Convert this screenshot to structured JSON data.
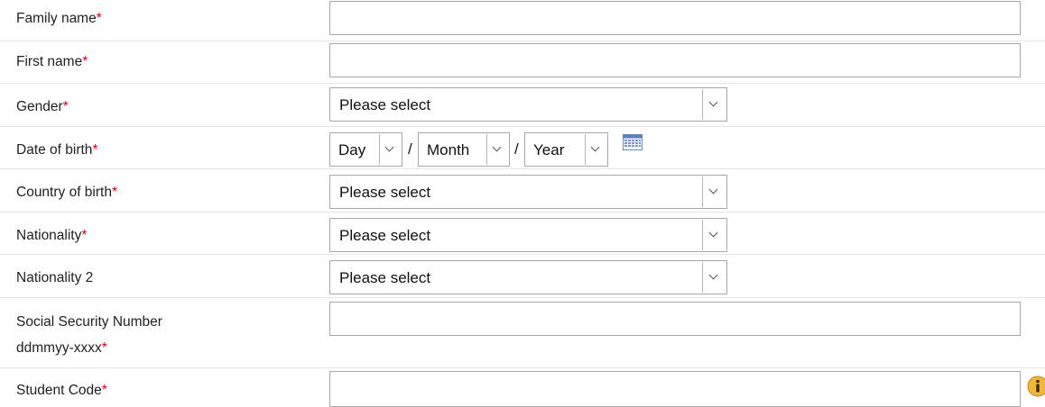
{
  "form": {
    "family_name": {
      "label": "Family name",
      "required": "*",
      "value": ""
    },
    "first_name": {
      "label": "First name",
      "required": "*",
      "value": ""
    },
    "gender": {
      "label": "Gender",
      "required": "*",
      "selected": "Please select"
    },
    "date_of_birth": {
      "label": "Date of birth",
      "required": "*",
      "day": "Day",
      "month": "Month",
      "year": "Year",
      "separator": "/",
      "calendar_icon": "calendar-icon"
    },
    "country_of_birth": {
      "label": "Country of birth",
      "required": "*",
      "selected": "Please select"
    },
    "nationality": {
      "label": "Nationality",
      "required": "*",
      "selected": "Please select"
    },
    "nationality_2": {
      "label": "Nationality 2",
      "selected": "Please select"
    },
    "ssn": {
      "label_line1": "Social Security Number",
      "label_line2": "ddmmyy-xxxx",
      "required": "*",
      "value": ""
    },
    "student_code": {
      "label": "Student Code",
      "required": "*",
      "value": "",
      "info_icon": "info-icon"
    }
  },
  "colors": {
    "required": "#d0021b",
    "border": "#a9a9a9",
    "row_divider": "#e6e6e6",
    "info_icon_fill": "#f0b63a"
  }
}
